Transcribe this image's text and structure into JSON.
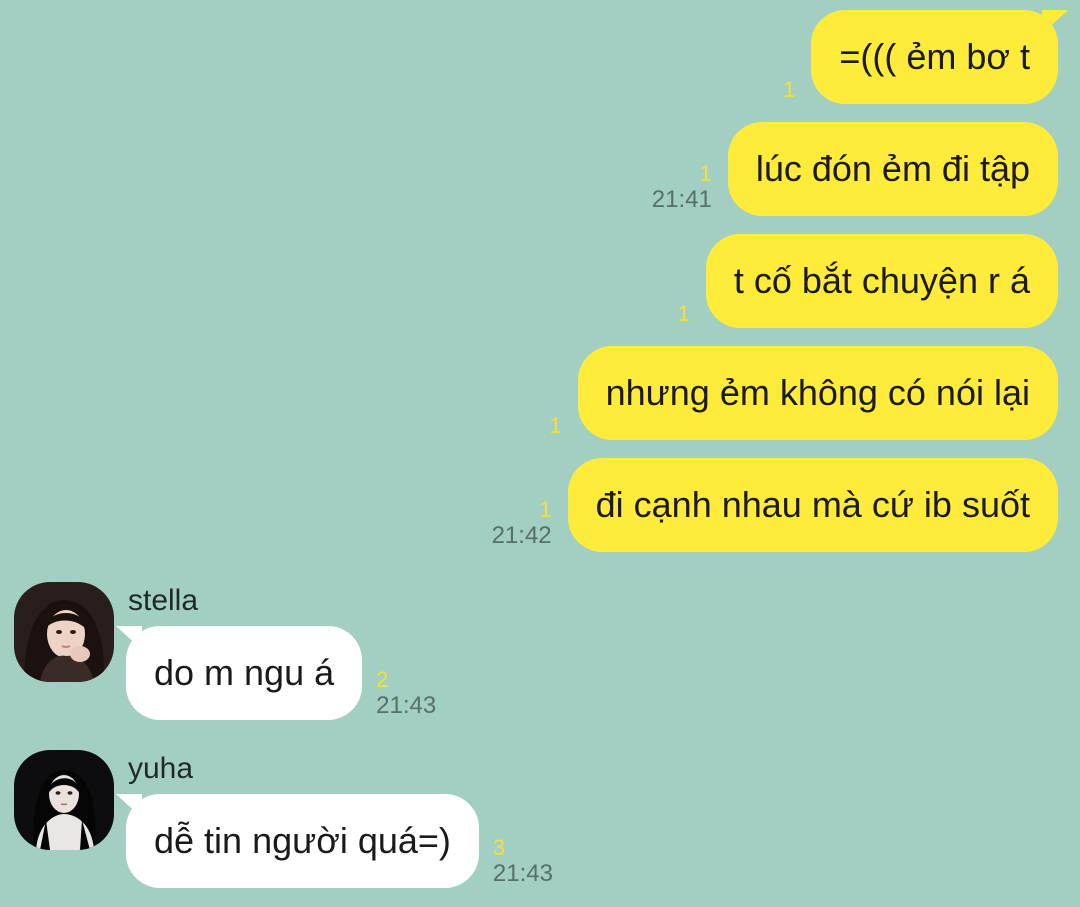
{
  "outgoing": [
    {
      "text": "=((( ẻm bơ t",
      "unread": "1",
      "time": ""
    },
    {
      "text": "lúc đón ẻm đi tập",
      "unread": "1",
      "time": "21:41"
    },
    {
      "text": "t cố bắt chuyện r á",
      "unread": "1",
      "time": ""
    },
    {
      "text": "nhưng ẻm không có nói lại",
      "unread": "1",
      "time": ""
    },
    {
      "text": "đi cạnh nhau mà cứ ib suốt",
      "unread": "1",
      "time": "21:42"
    }
  ],
  "incoming": [
    {
      "sender": "stella",
      "text": "do m ngu á",
      "unread": "2",
      "time": "21:43"
    },
    {
      "sender": "yuha",
      "text": "dễ tin người quá=)",
      "unread": "3",
      "time": "21:43"
    }
  ],
  "colors": {
    "background": "#a3cfc2",
    "outgoing_bubble": "#ffeb3b",
    "incoming_bubble": "#ffffff",
    "unread_count": "#f5e03a",
    "timestamp": "#55706a"
  },
  "icons": {
    "avatar_stella": "profile-photo",
    "avatar_yuha": "profile-photo"
  }
}
